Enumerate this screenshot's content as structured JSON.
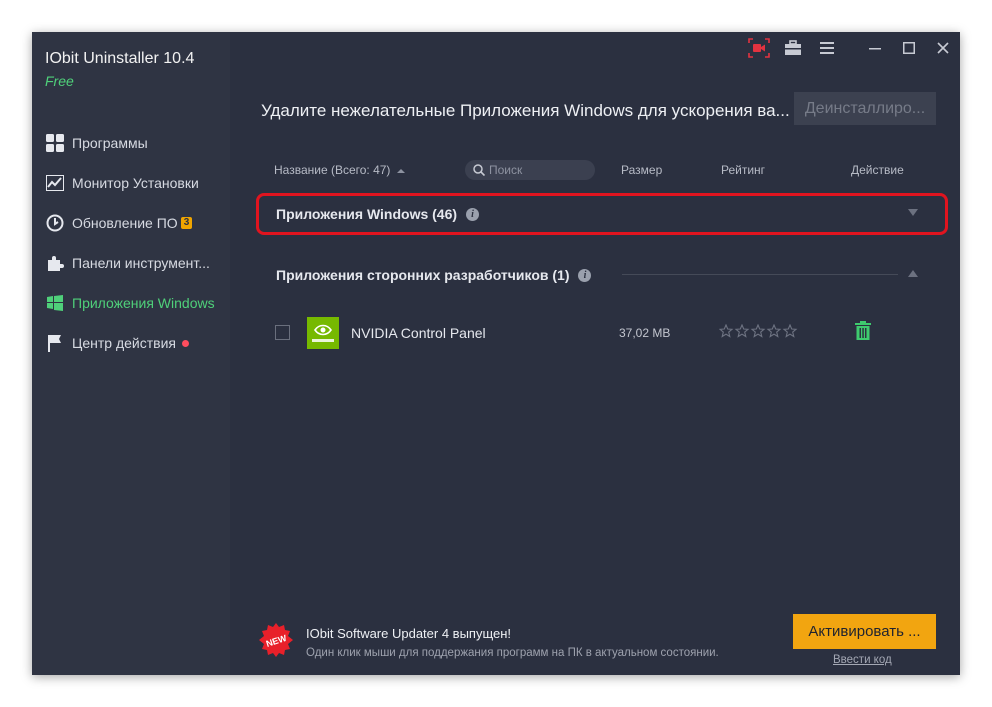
{
  "app": {
    "title": "IObit Uninstaller 10.4",
    "edition": "Free"
  },
  "sidebar": {
    "items": [
      {
        "label": "Программы",
        "icon": "grid-icon"
      },
      {
        "label": "Монитор Установки",
        "icon": "chart-icon"
      },
      {
        "label": "Обновление ПО",
        "icon": "update-icon",
        "badge": "3"
      },
      {
        "label": "Панели инструмент...",
        "icon": "puzzle-icon"
      },
      {
        "label": "Приложения Windows",
        "icon": "windows-icon",
        "active": true
      },
      {
        "label": "Центр действия",
        "icon": "flag-icon",
        "dot": true
      }
    ]
  },
  "toolbar": {
    "icons": [
      "screen-record-icon",
      "toolbox-icon",
      "menu-icon",
      "minimize-icon",
      "maximize-icon",
      "close-icon"
    ]
  },
  "main": {
    "headline": "Удалите нежелательные Приложения Windows для ускорения ва...",
    "uninstall_button": "Деинсталлиро...",
    "columns": {
      "name": "Название (Всего: 47)",
      "size": "Размер",
      "rating": "Рейтинг",
      "action": "Действие"
    },
    "search": {
      "placeholder": "Поиск"
    },
    "groups": [
      {
        "title": "Приложения Windows (46)",
        "collapsed": true
      },
      {
        "title": "Приложения сторонних разработчиков (1)",
        "collapsed": false
      }
    ],
    "apps": [
      {
        "name": "NVIDIA Control Panel",
        "size": "37,02 MB",
        "rating": 0,
        "icon": "nvidia-icon"
      }
    ]
  },
  "footer": {
    "promo_badge": "NEW",
    "promo_title": "IObit Software Updater 4 выпущен!",
    "promo_subtitle": "Один клик мыши для поддержания программ на ПК в актуальном состоянии.",
    "activate_button": "Активировать ...",
    "enter_code": "Ввести код"
  },
  "colors": {
    "accent_green": "#4fd07a",
    "highlight_red": "#e0141f",
    "activate_orange": "#f2a510",
    "badge_orange": "#f0a500"
  }
}
